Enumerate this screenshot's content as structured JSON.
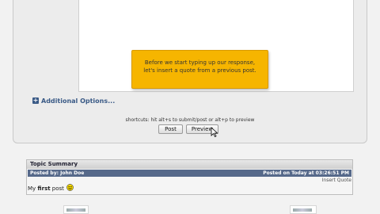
{
  "tooltip": {
    "line1": "Before we start typing up our response,",
    "line2": "let's insert a quote from a previous post."
  },
  "additional_options": {
    "label": "Additional Options..."
  },
  "shortcuts": {
    "text": "shortcuts: hit alt+s to submit/post or alt+p to preview"
  },
  "buttons": {
    "post": "Post",
    "preview": "Preview"
  },
  "topic_summary": {
    "title": "Topic Summary",
    "posted_by": "Posted by: John Doe",
    "posted_on": "Posted on Today at 03:26:51 PM",
    "insert_quote": "Insert Quote",
    "post_text_prefix": "My ",
    "post_text_bold": "first",
    "post_text_suffix": " post"
  },
  "icons": {
    "plus": "plus-icon",
    "cursor": "mouse-cursor-icon",
    "smiley": "smiley-icon"
  },
  "colors": {
    "tooltip_bg": "#f6b500",
    "header_bar": "#56698a",
    "link": "#3a5a86"
  }
}
